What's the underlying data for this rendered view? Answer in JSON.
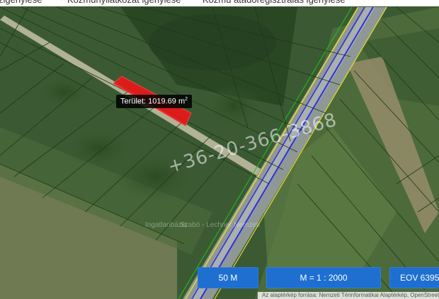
{
  "topbar": {
    "tab1": "zigénylése",
    "tab2": "Közműnyilatkozat igénylése",
    "tab3": "Közmű átadóregisztrálás igénylése"
  },
  "map": {
    "area_label": "Terület: 1019.69 m",
    "area_unit_sup": "2",
    "watermark_phone": "+36-20-366-3868",
    "watermark_name_1": "Ingatlanbázis",
    "watermark_name_2": "Szabó - Lechner Nemzeti",
    "colors": {
      "parcel_fill": "#e81818",
      "parcel_lines": "#1b3a18",
      "road_border": "#2f2fe0",
      "road_side": "#e5d92b",
      "selection_line": "#20c020"
    }
  },
  "controls": {
    "scale_bar": "50 M",
    "ratio": "M = 1 : 2000",
    "eov": "EOV   6395"
  },
  "attribution": "Az alaptérkép forrása: Nemzeti Térinformatikai Alaptérkép, OpenStreetMap"
}
